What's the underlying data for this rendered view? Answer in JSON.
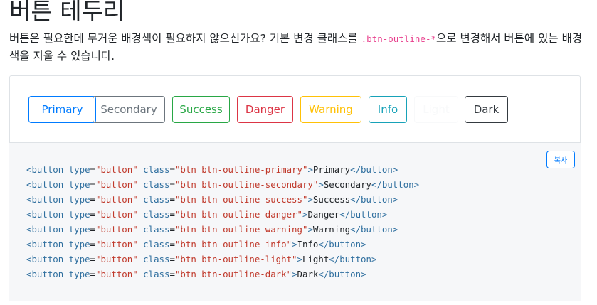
{
  "heading": "버튼 테두리",
  "lead": {
    "before": "버튼은 필요한데 무거운 배경색이 필요하지 않으신가요? 기본 변경 클래스를 ",
    "code": ".btn-outline-*",
    "after": "으로 변경해서 버튼에 있는 배경색을 지울 수 있습니다."
  },
  "example": {
    "buttons": [
      {
        "label": "Primary",
        "variant": "primary",
        "color": "#007bff"
      },
      {
        "label": "Secondary",
        "variant": "secondary",
        "color": "#6c757d"
      },
      {
        "label": "Success",
        "variant": "success",
        "color": "#28a745"
      },
      {
        "label": "Danger",
        "variant": "danger",
        "color": "#dc3545"
      },
      {
        "label": "Warning",
        "variant": "warning",
        "color": "#ffc107"
      },
      {
        "label": "Info",
        "variant": "info",
        "color": "#17a2b8"
      },
      {
        "label": "Light",
        "variant": "light",
        "color": "#f8f9fa"
      },
      {
        "label": "Dark",
        "variant": "dark",
        "color": "#343a40"
      }
    ]
  },
  "code_block": {
    "copy_label": "복사",
    "tag_open": "<button",
    "attr_type": "type",
    "type_value": "\"button\"",
    "attr_class": "class",
    "tag_close": "</button>",
    "lines": [
      {
        "class_value": "\"btn btn-outline-primary\"",
        "text": "Primary"
      },
      {
        "class_value": "\"btn btn-outline-secondary\"",
        "text": "Secondary"
      },
      {
        "class_value": "\"btn btn-outline-success\"",
        "text": "Success"
      },
      {
        "class_value": "\"btn btn-outline-danger\"",
        "text": "Danger"
      },
      {
        "class_value": "\"btn btn-outline-warning\"",
        "text": "Warning"
      },
      {
        "class_value": "\"btn btn-outline-info\"",
        "text": "Info"
      },
      {
        "class_value": "\"btn btn-outline-light\"",
        "text": "Light"
      },
      {
        "class_value": "\"btn btn-outline-dark\"",
        "text": "Dark"
      }
    ]
  }
}
